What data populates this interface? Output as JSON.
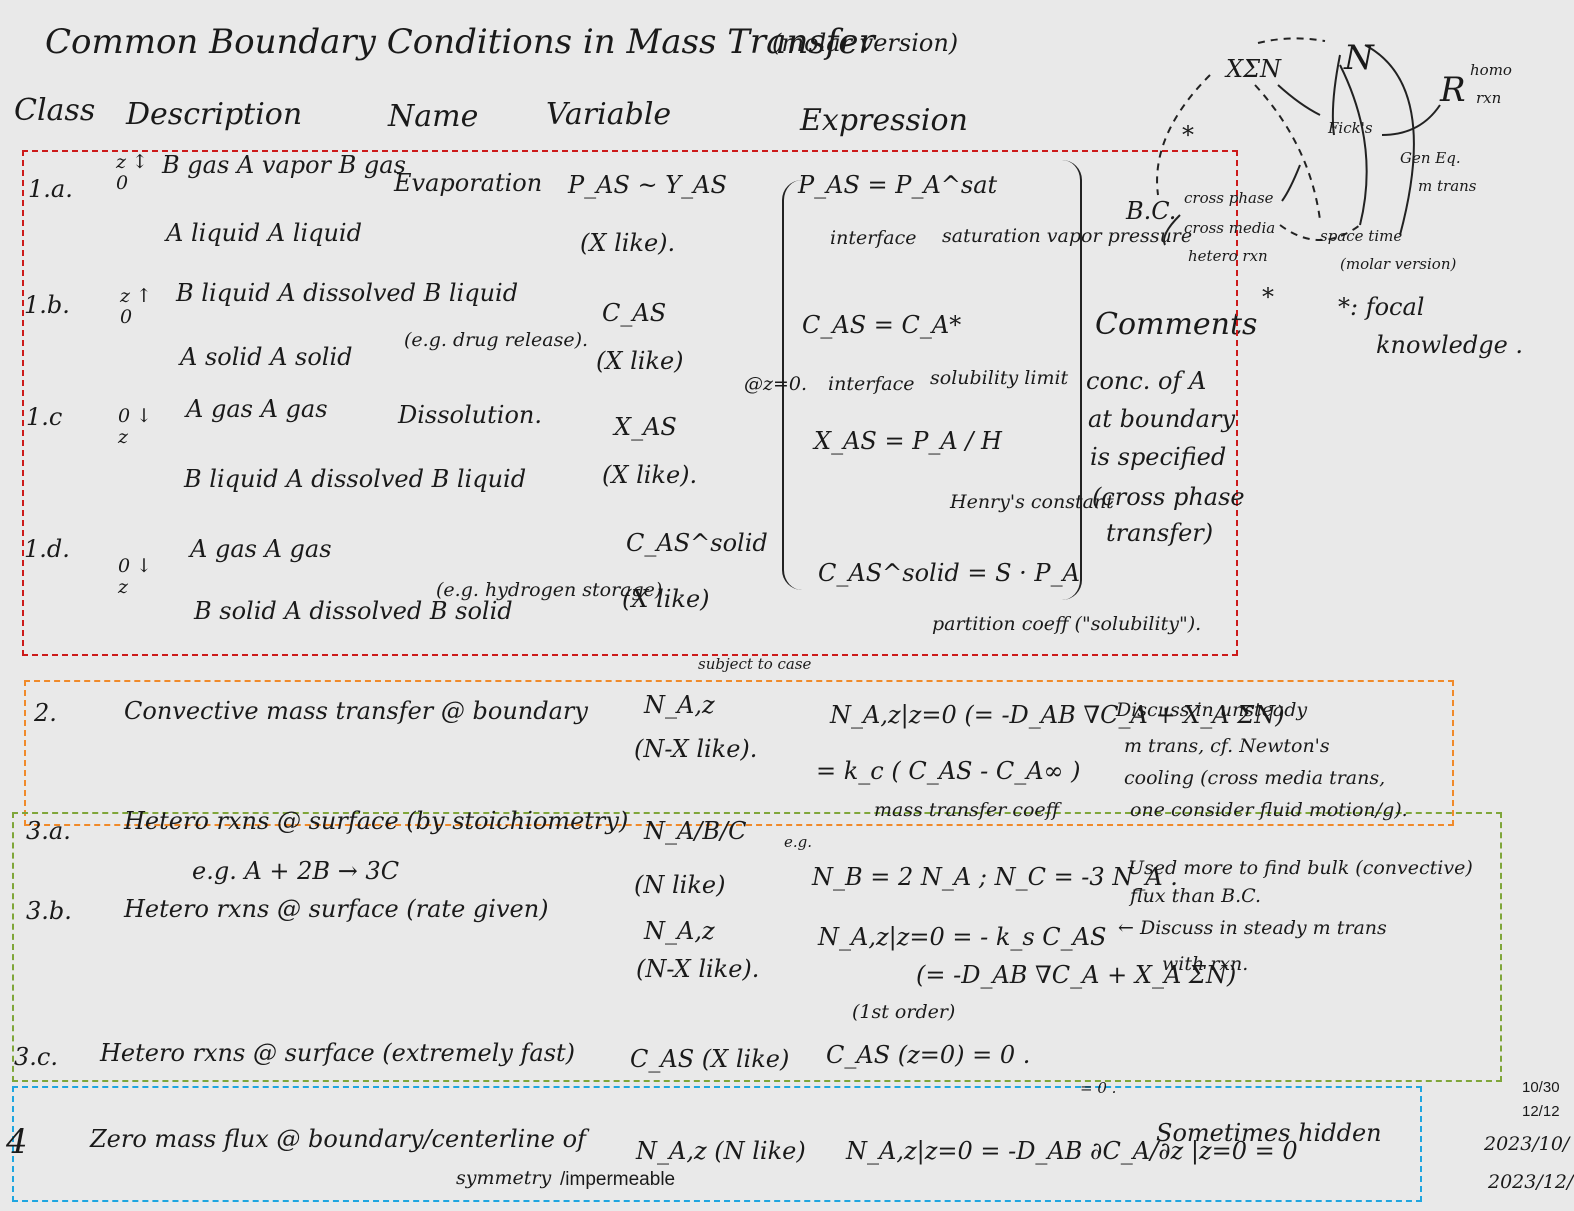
{
  "title": "Common Boundary Conditions in Mass Transfer",
  "title_note": "(molar version)",
  "headers": {
    "class": "Class",
    "description": "Description",
    "name": "Name",
    "variable": "Variable",
    "expression": "Expression",
    "comments": "Comments"
  },
  "rows": {
    "r1a": {
      "cls": "1.a.",
      "desc_top": "B gas  A vapor  B gas",
      "desc_bottom": "A liquid     A liquid",
      "name": "Evaporation",
      "variable": "P_AS ~ Y_AS",
      "like": "(X like).",
      "expr": "P_AS = P_A^sat",
      "expr_note1": "interface",
      "expr_note2": "saturation vapor pressure"
    },
    "r1b": {
      "cls": "1.b.",
      "desc_top": "B liquid  A dissolved  B liquid",
      "desc_bottom": "A solid     A solid",
      "name": "(e.g. drug release).",
      "variable": "C_AS",
      "like": "(X like)",
      "expr": "C_AS = C_A*",
      "at": "@z=0.",
      "expr_note1": "interface",
      "expr_note2": "solubility limit"
    },
    "r1c": {
      "cls": "1.c",
      "desc_top": "A gas        A gas",
      "desc_bottom": "B liquid  A dissolved  B liquid",
      "name": "Dissolution.",
      "variable": "X_AS",
      "like": "(X like).",
      "expr": "X_AS = P_A / H",
      "expr_note": "Henry's constant"
    },
    "r1d": {
      "cls": "1.d.",
      "desc_top": "A gas        A gas",
      "desc_bottom": "B solid  A dissolved  B solid",
      "name": "(e.g. hydrogen storage)",
      "variable": "C_AS^solid",
      "like": "(X like)",
      "expr": "C_AS^solid = S · P_A",
      "expr_note": "partition coeff (\"solubility\")."
    },
    "comment1": [
      "conc. of A",
      "at boundary",
      "is specified",
      "(cross phase",
      "transfer)"
    ],
    "r2": {
      "cls": "2.",
      "desc": "Convective mass transfer @ boundary",
      "subject": "subject to case",
      "variable": "N_A,z",
      "like": "(N-X like).",
      "expr1": "N_A,z|z=0 (= -D_AB ∇C_A + X_A ΣN)",
      "expr2": "= k_c ( C_AS - C_A∞ )",
      "expr_note": "mass transfer coeff",
      "comment": [
        "Discuss in unsteady",
        "m trans, cf. Newton's",
        "cooling (cross media trans,",
        "one consider fluid motion/g)."
      ]
    },
    "r3a": {
      "cls": "3.a.",
      "desc": "Hetero rxns @ surface (by stoichiometry)",
      "eg": "e.g.  A + 2B → 3C",
      "variable": "N_A/B/C",
      "like": "(N like)",
      "eg_label": "e.g.",
      "expr": "N_B = 2 N_A ;  N_C = -3 N_A .",
      "comment": [
        "Used more to find bulk (convective)",
        "flux than B.C."
      ]
    },
    "r3b": {
      "cls": "3.b.",
      "desc": "Hetero rxns @ surface (rate given)",
      "variable": "N_A,z",
      "like": "(N-X like).",
      "expr1": "N_A,z|z=0 = - k_s C_AS",
      "expr2": "(= -D_AB ∇C_A + X_A ΣN)",
      "expr3": "(1st order)",
      "comment": [
        "← Discuss in steady m trans",
        "with rxn."
      ]
    },
    "r3c": {
      "cls": "3.c.",
      "desc": "Hetero rxns @ surface (extremely fast)",
      "variable": "C_AS (X like)",
      "expr": "C_AS (z=0) = 0 ."
    },
    "r4": {
      "cls": "4",
      "desc": "Zero mass flux @ boundary/centerline of",
      "desc2": "symmetry",
      "desc3": "/impermeable",
      "variable": "N_A,z (N like)",
      "expr": "N_A,z|z=0 = -D_AB ∂C_A/∂z |z=0 = 0",
      "top_zero": "= 0 .",
      "comment": "Sometimes hidden"
    }
  },
  "diagram": {
    "xsn": "XΣN",
    "n": "N",
    "r": "R",
    "homo": "homo",
    "rxn": "rxn",
    "ficks": "Fick's",
    "gen_eq": "Gen Eq.",
    "m_trans": "m trans",
    "bc": "B.C.",
    "bc_items": [
      "cross phase",
      "cross media",
      "hetero rxn"
    ],
    "space_time": "space time",
    "molar": "(molar version)",
    "star": "*",
    "focal": "*: focal",
    "knowledge": "knowledge ."
  },
  "dates": [
    "10/30",
    "12/12",
    "2023/10/",
    "2023/12/"
  ]
}
